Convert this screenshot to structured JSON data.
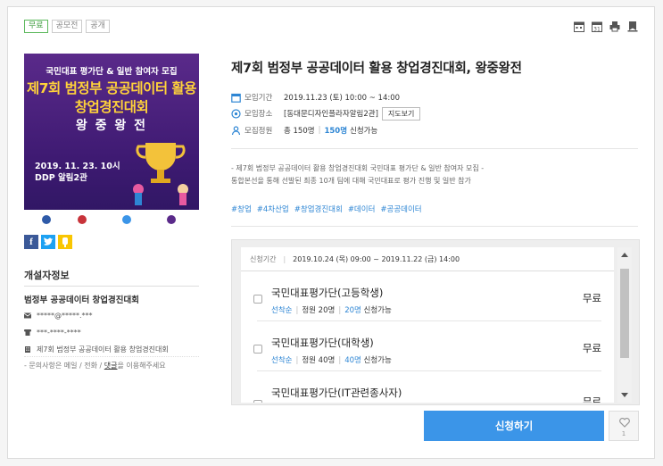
{
  "tags": [
    "무료",
    "공모전",
    "공개"
  ],
  "poster": {
    "line1": "국민대표 평가단 & 일반 참여자 모집",
    "line2": "제7회 범정부 공공데이터 활용",
    "line3": "창업경진대회",
    "line4": "왕 중 왕 전",
    "date": "2019. 11. 23. 10시",
    "venue": "DDP 알림2관"
  },
  "social": {
    "facebook": "f",
    "twitter": "t",
    "kakao": "k"
  },
  "host": {
    "section_title": "개설자정보",
    "name": "범정부 공공데이터 창업경진대회",
    "email": "*****@*****.***",
    "phone": "***-****-****",
    "org": "제7회 범정부 공공데이터 활용 창업경진대회",
    "note_prefix": "- 문의사항은 메일 / 전화 / ",
    "note_link": "댓글",
    "note_suffix": "을 이용해주세요"
  },
  "event": {
    "title": "제7회 범정부 공공데이터 활용 창업경진대회, 왕중왕전",
    "date_label": "모임기간",
    "date_value": "2019.11.23 (토) 10:00 ~ 14:00",
    "place_label": "모임장소",
    "place_value": "[동대문디자인플라자알림2관]",
    "map_button": "지도보기",
    "capacity_label": "모집정원",
    "capacity_total": "총 150명",
    "capacity_sep": "|",
    "capacity_avail_num": "150명",
    "capacity_avail_text": "신청가능",
    "description_line1": "- 제7회 범정부 공공데이터 활용 창업경진대회 국민대표 평가단 & 일반 참여자 모집 -",
    "description_line2": "통합본선을 통해 선발된 최종 10개 팀에 대해 국민대표로 평가 진행 및 일반 참가",
    "hashtags": [
      "#창업",
      "#4차산업",
      "#창업경진대회",
      "#데이터",
      "#공공데이터"
    ]
  },
  "registration": {
    "period_label": "신청기간",
    "period_value": "2019.10.24 (목) 09:00 ~ 2019.11.22 (금) 14:00",
    "tickets": [
      {
        "name": "국민대표평가단(고등학생)",
        "price": "무료",
        "type": "선착순",
        "quota": "정원 20명",
        "avail_num": "20명",
        "avail_text": "신청가능"
      },
      {
        "name": "국민대표평가단(대학생)",
        "price": "무료",
        "type": "선착순",
        "quota": "정원 40명",
        "avail_num": "40명",
        "avail_text": "신청가능"
      },
      {
        "name": "국민대표평가단(IT관련종사자)",
        "price": "무료",
        "type": "",
        "quota": "",
        "avail_num": "",
        "avail_text": ""
      }
    ],
    "apply_button": "신청하기",
    "like_count": "1"
  }
}
